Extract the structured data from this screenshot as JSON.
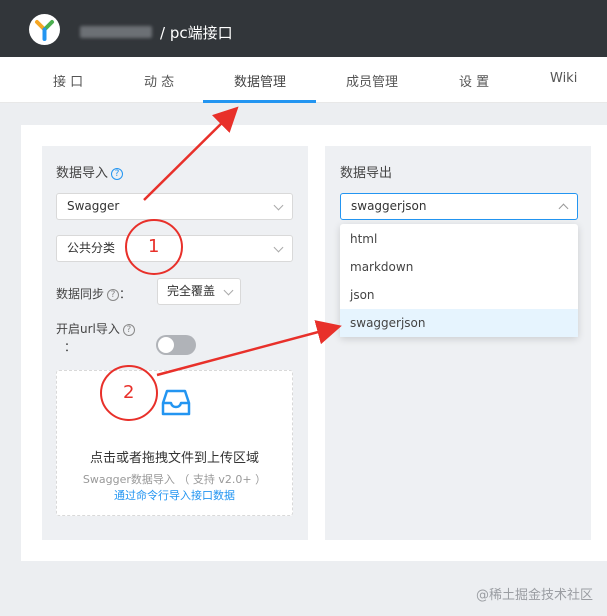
{
  "header": {
    "project_title": "/ pc端接口"
  },
  "tabs": [
    {
      "label": "接 口"
    },
    {
      "label": "动 态"
    },
    {
      "label": "数据管理"
    },
    {
      "label": "成员管理"
    },
    {
      "label": "设 置"
    },
    {
      "label": "Wiki"
    }
  ],
  "active_tab": "数据管理",
  "import": {
    "title": "数据导入",
    "type_select": "Swagger",
    "category_select": "公共分类",
    "sync_label": "数据同步",
    "sync_select": "完全覆盖",
    "url_import_label": "开启url导入",
    "url_import_colon": "：",
    "url_import_enabled": false,
    "dropzone": {
      "title": "点击或者拖拽文件到上传区域",
      "subtitle": "Swagger数据导入 （ 支持 v2.0+ ）",
      "link": "通过命令行导入接口数据"
    }
  },
  "export": {
    "title": "数据导出",
    "select": "swaggerjson",
    "options": [
      "html",
      "markdown",
      "json",
      "swaggerjson"
    ],
    "selected_option": "swaggerjson"
  },
  "annotations": {
    "step1": "1",
    "step2": "2"
  },
  "watermark": "@稀土掘金技术社区",
  "colors": {
    "topbar": "#32363a",
    "accent": "#2395f1",
    "annotation_red": "#e8302a"
  }
}
